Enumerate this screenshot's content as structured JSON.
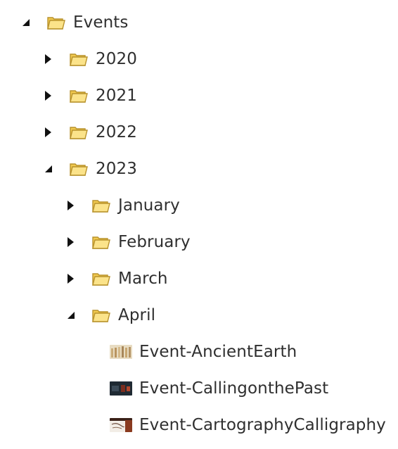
{
  "tree": {
    "root": {
      "label": "Events",
      "expanded": true,
      "icon": "folder-icon"
    },
    "years": [
      {
        "label": "2020",
        "expanded": false,
        "icon": "folder-icon"
      },
      {
        "label": "2021",
        "expanded": false,
        "icon": "folder-icon"
      },
      {
        "label": "2022",
        "expanded": false,
        "icon": "folder-icon"
      },
      {
        "label": "2023",
        "expanded": true,
        "icon": "folder-icon"
      }
    ],
    "months": [
      {
        "label": "January",
        "expanded": false,
        "icon": "folder-icon"
      },
      {
        "label": "February",
        "expanded": false,
        "icon": "folder-icon"
      },
      {
        "label": "March",
        "expanded": false,
        "icon": "folder-icon"
      },
      {
        "label": "April",
        "expanded": true,
        "icon": "folder-icon"
      }
    ],
    "items": [
      {
        "label": "Event-AncientEarth",
        "icon": "image-thumbnail-icon"
      },
      {
        "label": "Event-CallingonthePast",
        "icon": "image-thumbnail-icon"
      },
      {
        "label": "Event-CartographyCalligraphy",
        "icon": "image-thumbnail-icon"
      }
    ]
  },
  "colors": {
    "folder_fill": "#f6d66a",
    "folder_outline": "#c9a23a",
    "text": "#2f2f2f",
    "toggle": "#111111"
  }
}
